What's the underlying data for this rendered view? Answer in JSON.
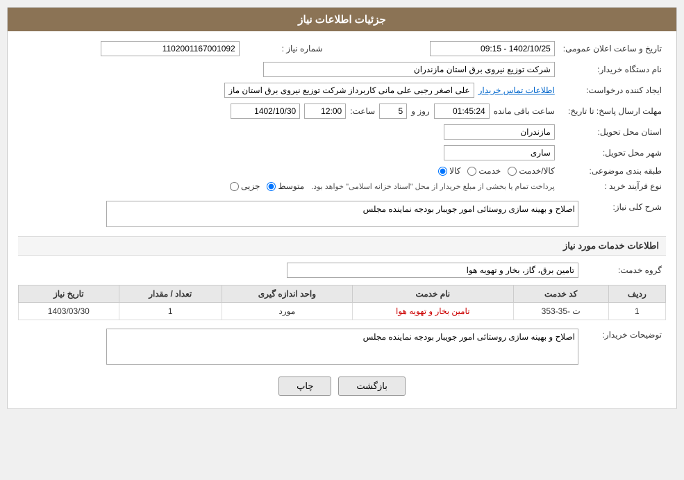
{
  "header": {
    "title": "جزئیات اطلاعات نیاز"
  },
  "fields": {
    "need_number_label": "شماره نیاز :",
    "need_number_value": "1102001167001092",
    "buyer_org_label": "نام دستگاه خریدار:",
    "buyer_org_value": "شرکت توزیع نیروی برق استان مازندران",
    "creator_label": "ایجاد کننده درخواست:",
    "creator_value": "علی اصغر رجبی علی مانی کاربرداز شرکت توزیع نیروی برق استان مازندران",
    "contact_link": "اطلاعات تماس خریدار",
    "send_deadline_label": "مهلت ارسال پاسخ: تا تاریخ:",
    "send_date": "1402/10/30",
    "send_time_label": "ساعت:",
    "send_time": "12:00",
    "send_days_label": "روز و",
    "send_days": "5",
    "send_remaining_label": "ساعت باقی مانده",
    "send_remaining": "01:45:24",
    "province_label": "استان محل تحویل:",
    "province_value": "مازندران",
    "city_label": "شهر محل تحویل:",
    "city_value": "ساری",
    "category_label": "طبقه بندی موضوعی:",
    "category_kala": "کالا",
    "category_khadamat": "خدمت",
    "category_kala_khadamat": "کالا/خدمت",
    "purchase_type_label": "نوع فرآیند خرید :",
    "purchase_jozii": "جزیی",
    "purchase_motavaset": "متوسط",
    "purchase_note": "پرداخت تمام یا بخشی از مبلغ خریدار از محل \"اسناد خزانه اسلامی\" خواهد بود.",
    "announce_label": "تاریخ و ساعت اعلان عمومی:",
    "announce_value": "1402/10/25 - 09:15"
  },
  "description_section": {
    "label": "شرح کلی نیاز:",
    "value": "اصلاح و بهینه سازی روستائی امور جویبار بودجه نماینده مجلس"
  },
  "services_section": {
    "title": "اطلاعات خدمات مورد نیاز",
    "service_group_label": "گروه خدمت:",
    "service_group_value": "تامین برق، گاز، بخار و تهویه هوا",
    "table": {
      "columns": [
        "ردیف",
        "کد خدمت",
        "نام خدمت",
        "واحد اندازه گیری",
        "تعداد / مقدار",
        "تاریخ نیاز"
      ],
      "rows": [
        {
          "row_num": "1",
          "code": "ت -35-353",
          "name": "تامین بخار و تهویه هوا",
          "unit": "مورد",
          "quantity": "1",
          "date": "1403/03/30"
        }
      ]
    }
  },
  "buyer_notes_section": {
    "label": "توضیحات خریدار:",
    "value": "اصلاح و بهینه سازی روستائی امور جویبار بودجه نماینده مجلس"
  },
  "buttons": {
    "print": "چاپ",
    "back": "بازگشت"
  }
}
